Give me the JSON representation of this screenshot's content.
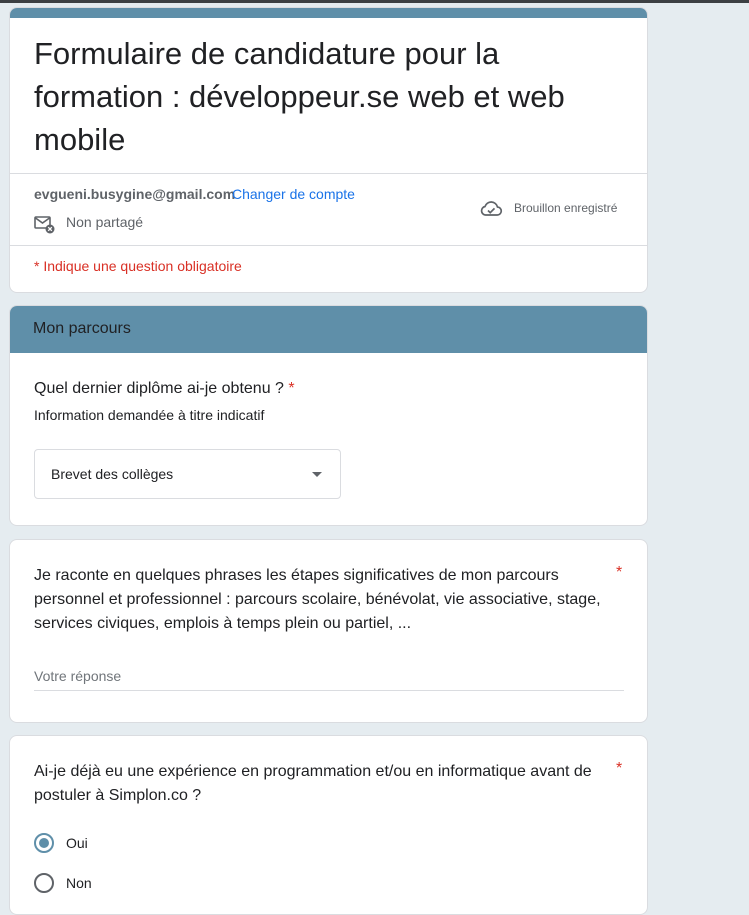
{
  "form": {
    "title": "Formulaire de candidature pour la formation : développeur.se web et web mobile",
    "account_email": "evgueni.busygine@gmail.com",
    "switch_account": "Changer de compte",
    "share_status": "Non partagé",
    "draft_status": "Brouillon enregistré",
    "required_note": "* Indique une question obligatoire",
    "accent_color": "#5f8fa9"
  },
  "section": {
    "title": "Mon parcours"
  },
  "questions": [
    {
      "text": "Quel dernier diplôme ai-je obtenu ?",
      "star": "*",
      "description": "Information demandée à titre indicatif",
      "selected": "Brevet des collèges"
    },
    {
      "text": "Je raconte en quelques phrases les étapes significatives de mon parcours personnel et professionnel : parcours scolaire, bénévolat, vie associative, stage, services civiques, emplois à temps plein ou partiel, ...",
      "star": "*",
      "placeholder": "Votre réponse"
    },
    {
      "text": "Ai-je déjà eu une expérience en programmation et/ou en informatique avant de postuler à Simplon.co ?",
      "star": "*",
      "options": [
        "Oui",
        "Non"
      ],
      "selected_option": "Oui"
    }
  ]
}
